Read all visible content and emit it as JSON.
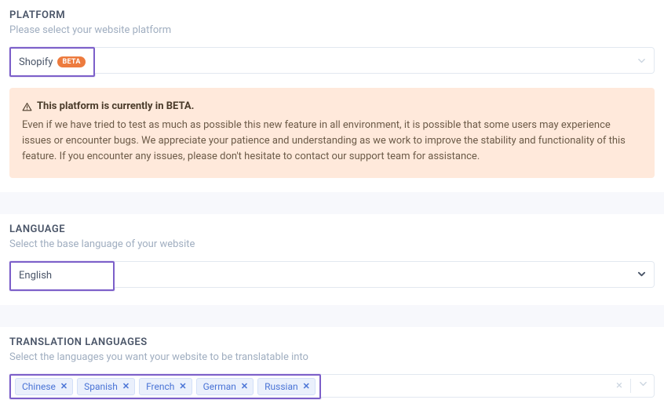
{
  "platform": {
    "title": "PLATFORM",
    "subtitle": "Please select your website platform",
    "selected": "Shopify",
    "badge": "BETA",
    "alert": {
      "title": "This platform is currently in BETA.",
      "body": "Even if we have tried to test as much as possible this new feature in all environment, it is possible that some users may experience issues or encounter bugs. We appreciate your patience and understanding as we work to improve the stability and functionality of this feature. If you encounter any issues, please don't hesitate to contact our support team for assistance."
    }
  },
  "language": {
    "title": "LANGUAGE",
    "subtitle": "Select the base language of your website",
    "selected": "English"
  },
  "translations": {
    "title": "TRANSLATION LANGUAGES",
    "subtitle": "Select the languages you want your website to be translatable into",
    "tags": [
      "Chinese",
      "Spanish",
      "French",
      "German",
      "Russian"
    ]
  }
}
